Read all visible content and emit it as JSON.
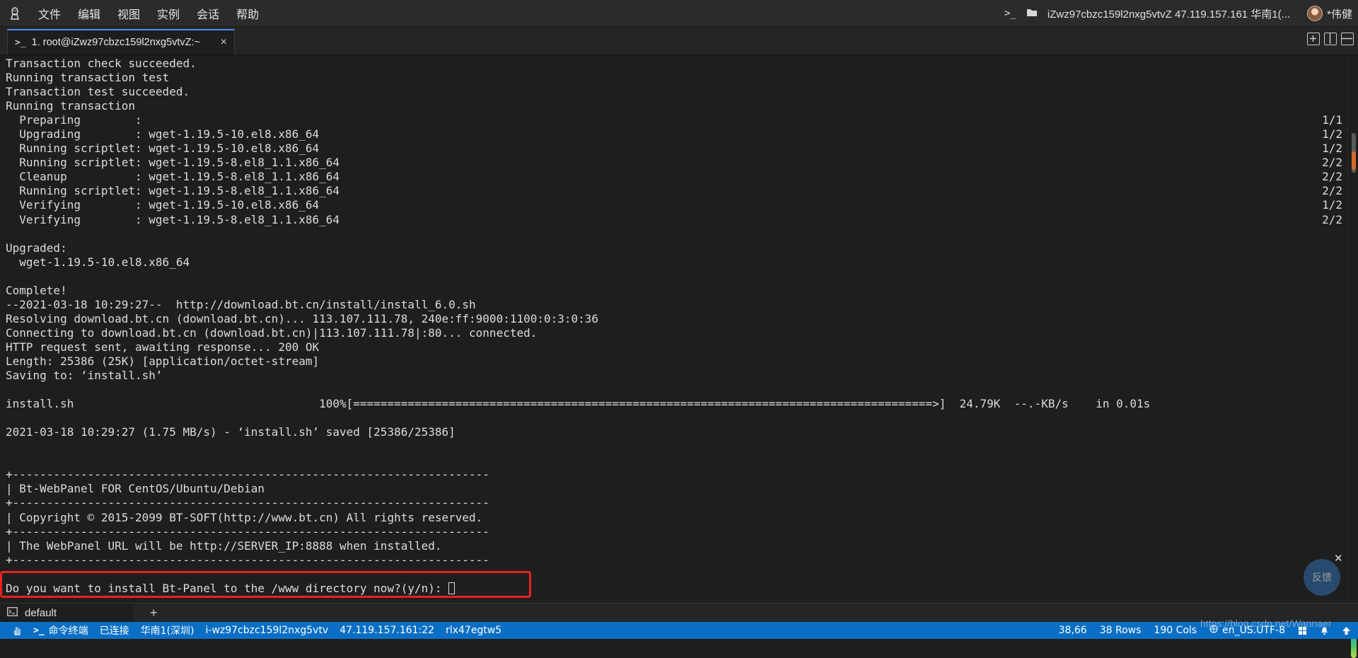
{
  "menubar": {
    "items": [
      "文件",
      "编辑",
      "视图",
      "实例",
      "会话",
      "帮助"
    ],
    "session_title": "iZwz97cbzc159l2nxg5vtvZ 47.119.157.161 华南1(...",
    "user_name": "*伟健"
  },
  "tab": {
    "label": "1. root@iZwz97cbzc159l2nxg5vtvZ:~",
    "close_glyph": "×"
  },
  "terminal": {
    "lines": [
      {
        "text": "Transaction check succeeded.",
        "right": ""
      },
      {
        "text": "Running transaction test",
        "right": ""
      },
      {
        "text": "Transaction test succeeded.",
        "right": ""
      },
      {
        "text": "Running transaction",
        "right": ""
      },
      {
        "text": "  Preparing        :",
        "right": "1/1"
      },
      {
        "text": "  Upgrading        : wget-1.19.5-10.el8.x86_64",
        "right": "1/2"
      },
      {
        "text": "  Running scriptlet: wget-1.19.5-10.el8.x86_64",
        "right": "1/2"
      },
      {
        "text": "  Running scriptlet: wget-1.19.5-8.el8_1.1.x86_64",
        "right": "2/2"
      },
      {
        "text": "  Cleanup          : wget-1.19.5-8.el8_1.1.x86_64",
        "right": "2/2"
      },
      {
        "text": "  Running scriptlet: wget-1.19.5-8.el8_1.1.x86_64",
        "right": "2/2"
      },
      {
        "text": "  Verifying        : wget-1.19.5-10.el8.x86_64",
        "right": "1/2"
      },
      {
        "text": "  Verifying        : wget-1.19.5-8.el8_1.1.x86_64",
        "right": "2/2"
      },
      {
        "text": "",
        "right": ""
      },
      {
        "text": "Upgraded:",
        "right": ""
      },
      {
        "text": "  wget-1.19.5-10.el8.x86_64",
        "right": ""
      },
      {
        "text": "",
        "right": ""
      },
      {
        "text": "Complete!",
        "right": ""
      },
      {
        "text": "--2021-03-18 10:29:27--  http://download.bt.cn/install/install_6.0.sh",
        "right": ""
      },
      {
        "text": "Resolving download.bt.cn (download.bt.cn)... 113.107.111.78, 240e:ff:9000:1100:0:3:0:36",
        "right": ""
      },
      {
        "text": "Connecting to download.bt.cn (download.bt.cn)|113.107.111.78|:80... connected.",
        "right": ""
      },
      {
        "text": "HTTP request sent, awaiting response... 200 OK",
        "right": ""
      },
      {
        "text": "Length: 25386 (25K) [application/octet-stream]",
        "right": ""
      },
      {
        "text": "Saving to: ‘install.sh’",
        "right": ""
      },
      {
        "text": "",
        "right": ""
      },
      {
        "text": "install.sh                                    100%[=====================================================================================>]  24.79K  --.-KB/s    in 0.01s",
        "right": ""
      },
      {
        "text": "",
        "right": ""
      },
      {
        "text": "2021-03-18 10:29:27 (1.75 MB/s) - ‘install.sh’ saved [25386/25386]",
        "right": ""
      },
      {
        "text": "",
        "right": ""
      },
      {
        "text": "",
        "right": ""
      },
      {
        "text": "+----------------------------------------------------------------------",
        "right": ""
      },
      {
        "text": "| Bt-WebPanel FOR CentOS/Ubuntu/Debian",
        "right": ""
      },
      {
        "text": "+----------------------------------------------------------------------",
        "right": ""
      },
      {
        "text": "| Copyright © 2015-2099 BT-SOFT(http://www.bt.cn) All rights reserved.",
        "right": ""
      },
      {
        "text": "+----------------------------------------------------------------------",
        "right": ""
      },
      {
        "text": "| The WebPanel URL will be http://SERVER_IP:8888 when installed.",
        "right": ""
      },
      {
        "text": "+----------------------------------------------------------------------",
        "right": ""
      },
      {
        "text": "",
        "right": ""
      }
    ],
    "prompt": "Do you want to install Bt-Panel to the /www directory now?(y/n): "
  },
  "feedback": {
    "label": "反馈",
    "close_glyph": "✕"
  },
  "panel": {
    "tab_label": "default",
    "add_glyph": "+"
  },
  "statusbar": {
    "terminal_label": "命令终端",
    "connection": "已连接",
    "region": "华南1(深圳)",
    "instance_id": "i-wz97cbzc159l2nxg5vtv",
    "address": "47.119.157.161:22",
    "session": "rlx47egtw5",
    "position": "38,66",
    "rows": "38 Rows",
    "cols": "190 Cols",
    "encoding": "en_US.UTF-8"
  },
  "watermark": "https://blog.csdn.net/Wannaer"
}
